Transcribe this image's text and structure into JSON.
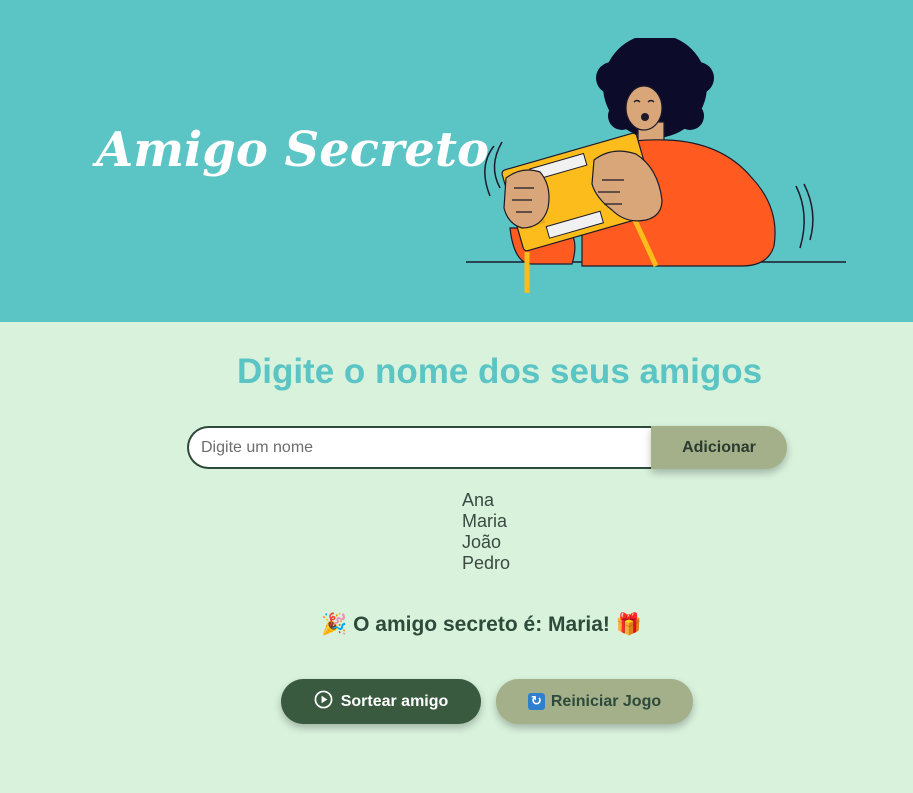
{
  "header": {
    "title": "Amigo Secreto",
    "illustration_icon": "person-holding-gift-illustration"
  },
  "main": {
    "heading": "Digite o nome dos seus amigos",
    "input": {
      "placeholder": "Digite um nome",
      "value": ""
    },
    "add_button_label": "Adicionar",
    "friends": [
      "Ana",
      "Maria",
      "João",
      "Pedro"
    ],
    "result": {
      "prefix_emoji": "🎉",
      "text": "O amigo secreto é: Maria!",
      "suffix_emoji": "🎁"
    },
    "draw_button": {
      "label": "Sortear amigo",
      "icon": "play-circle-icon"
    },
    "reset_button": {
      "label": "Reiniciar Jogo",
      "icon": "refresh-icon",
      "icon_glyph": "🔄"
    }
  },
  "colors": {
    "header_bg": "#5bc4c4",
    "page_bg": "#d8f2dc",
    "heading": "#5bc4c4",
    "primary_button": "#3a5a40",
    "secondary_button": "#a3b08a",
    "shirt": "#ff5a1f",
    "gift_box": "#fbbc1c"
  }
}
